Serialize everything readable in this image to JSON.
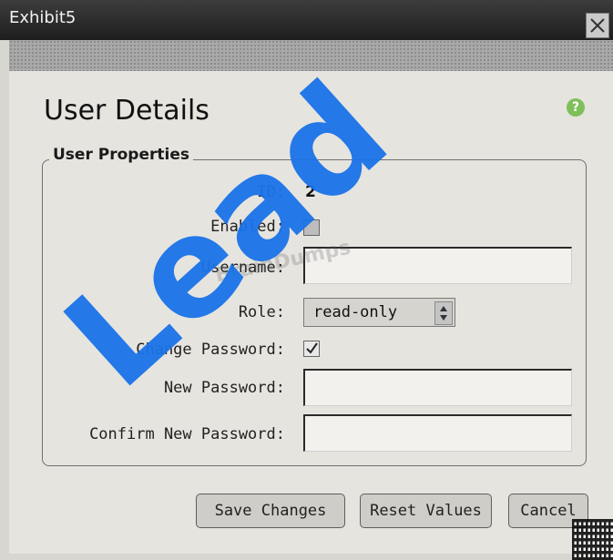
{
  "window": {
    "title": "Exhibit5",
    "close_icon": "close-icon"
  },
  "dialog": {
    "title": "User Details",
    "help_icon": "help-icon",
    "help_symbol": "?",
    "section_legend": "User Properties"
  },
  "form": {
    "id_label": "ID:",
    "id_value": "2",
    "enabled_label": "Enabled:",
    "enabled_checked": false,
    "username_label": "Username:",
    "username_value": "",
    "role_label": "Role:",
    "role_value": "read-only",
    "change_password_label": "Change Password:",
    "change_password_checked": true,
    "new_password_label": "New Password:",
    "new_password_value": "",
    "confirm_password_label": "Confirm New Password:",
    "confirm_password_value": ""
  },
  "buttons": {
    "save": "Save Changes",
    "reset": "Reset Values",
    "cancel": "Cancel"
  },
  "watermarks": {
    "primary": "Lead",
    "secondary": "BrainDumps"
  },
  "colors": {
    "watermark_blue": "#1a73e8",
    "help_green": "#7fbf5a",
    "title_bar": "#2a2a2a"
  }
}
